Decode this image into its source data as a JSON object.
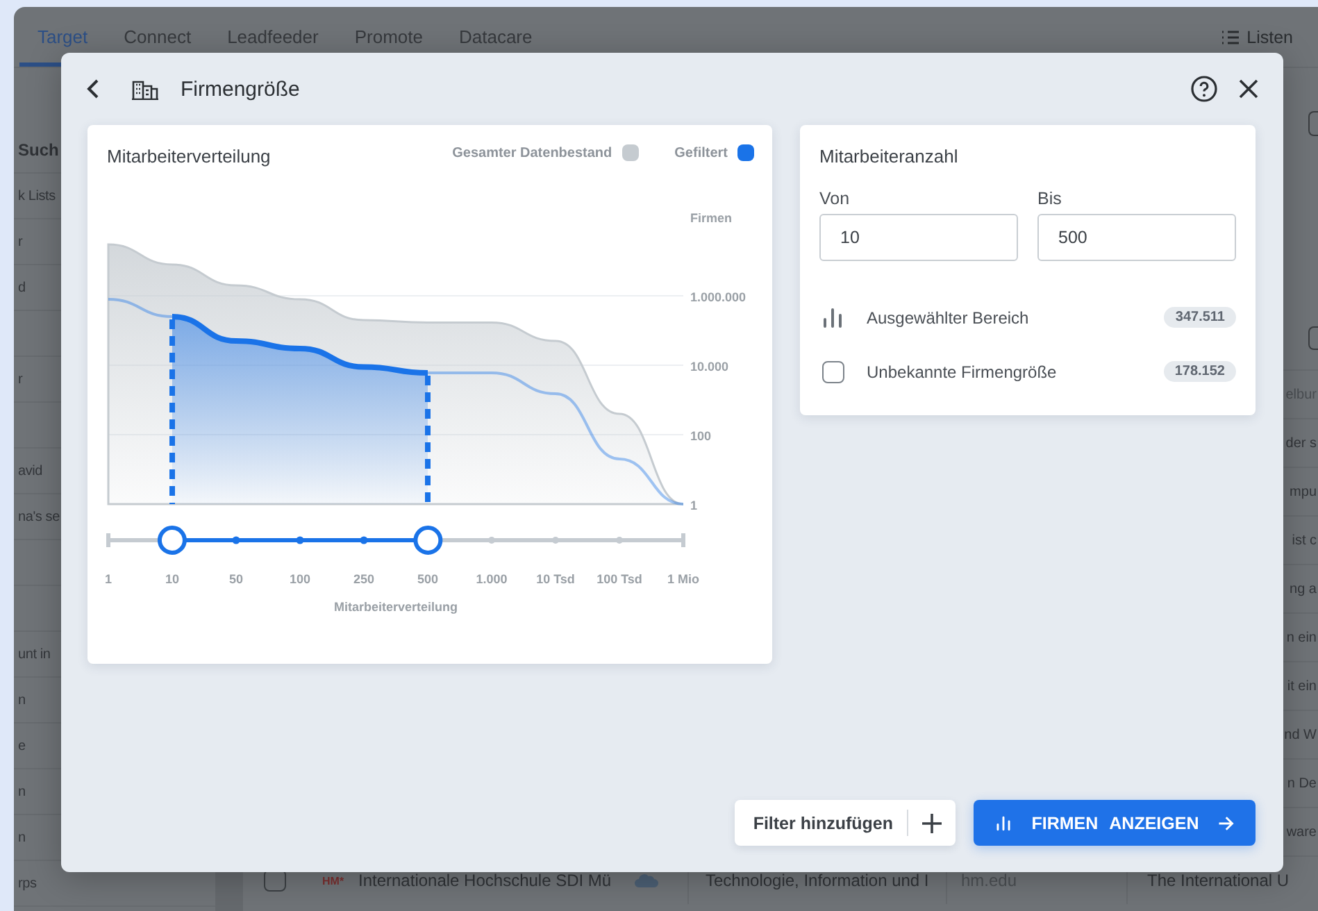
{
  "app": {
    "tabs": [
      {
        "label": "Target",
        "selected": true
      },
      {
        "label": "Connect",
        "selected": false
      },
      {
        "label": "Leadfeeder",
        "selected": false
      },
      {
        "label": "Promote",
        "selected": false
      },
      {
        "label": "Datacare",
        "selected": false
      }
    ],
    "lists_button": "Listen",
    "sidebar": {
      "items": [
        {
          "kind": "heading",
          "label": "Such"
        },
        {
          "kind": "text",
          "label": "k Lists"
        },
        {
          "kind": "text",
          "label": "r"
        },
        {
          "kind": "text",
          "label": "d"
        },
        {
          "kind": "blank"
        },
        {
          "kind": "text",
          "label": "r"
        },
        {
          "kind": "blank"
        },
        {
          "kind": "text",
          "label": "avid"
        },
        {
          "kind": "text",
          "label": "na's se"
        },
        {
          "kind": "blank"
        },
        {
          "kind": "blank"
        },
        {
          "kind": "text",
          "label": "unt in"
        },
        {
          "kind": "text",
          "label": "n"
        },
        {
          "kind": "text",
          "label": "e"
        },
        {
          "kind": "text",
          "label": "n"
        },
        {
          "kind": "text",
          "label": "n"
        },
        {
          "kind": "text",
          "label": "rps"
        }
      ]
    },
    "table": {
      "header": "elbur",
      "rows": [
        {
          "kind": "covered",
          "text": "der s"
        },
        {
          "kind": "covered",
          "text": "mpu"
        },
        {
          "kind": "covered",
          "text": "ist c"
        },
        {
          "kind": "covered",
          "text": "ng a"
        },
        {
          "kind": "covered",
          "text": "n ein"
        },
        {
          "kind": "covered",
          "text": "it ein"
        },
        {
          "kind": "covered",
          "text": "nd W"
        },
        {
          "kind": "covered",
          "text": "n De"
        },
        {
          "kind": "covered",
          "text": "ware"
        },
        {
          "kind": "full",
          "checked": false,
          "logo": "HM*",
          "name": "Internationale Hochschule SDI Mü",
          "industry": "Technologie, Information und I",
          "domain": "hm.edu",
          "description": "The International U"
        }
      ]
    }
  },
  "dialog": {
    "title": "Firmengröße",
    "chart_card": {
      "title": "Mitarbeiterverteilung",
      "legend": [
        {
          "label": "Gesamter Datenbestand",
          "color": "#c5cbd0"
        },
        {
          "label": "Gefiltert",
          "color": "#1a73e8"
        }
      ],
      "y_title": "Firmen",
      "y_labels": [
        "1.000.000",
        "10.000",
        "100",
        "1"
      ],
      "x_labels": [
        "1",
        "10",
        "50",
        "100",
        "250",
        "500",
        "1.000",
        "10 Tsd",
        "100 Tsd",
        "1 Mio"
      ],
      "x_title": "Mitarbeiterverteilung",
      "slider": {
        "thumbs": [
          {
            "level": 0.111
          },
          {
            "level": 0.556
          }
        ]
      }
    },
    "range_card": {
      "title": "Mitarbeiteranzahl",
      "from": {
        "label": "Von",
        "value": "10"
      },
      "to": {
        "label": "Bis",
        "value": "500"
      },
      "rows": [
        {
          "kind": "info",
          "label": "Ausgewählter Bereich",
          "count": "347.511"
        },
        {
          "kind": "checkbox",
          "checked": false,
          "label": "Unbekannte Firmengröße",
          "count": "178.152"
        }
      ]
    },
    "buttons": {
      "add_filter": "Filter hinzufügen",
      "show": "FIRMEN ANZEIGEN"
    }
  }
}
